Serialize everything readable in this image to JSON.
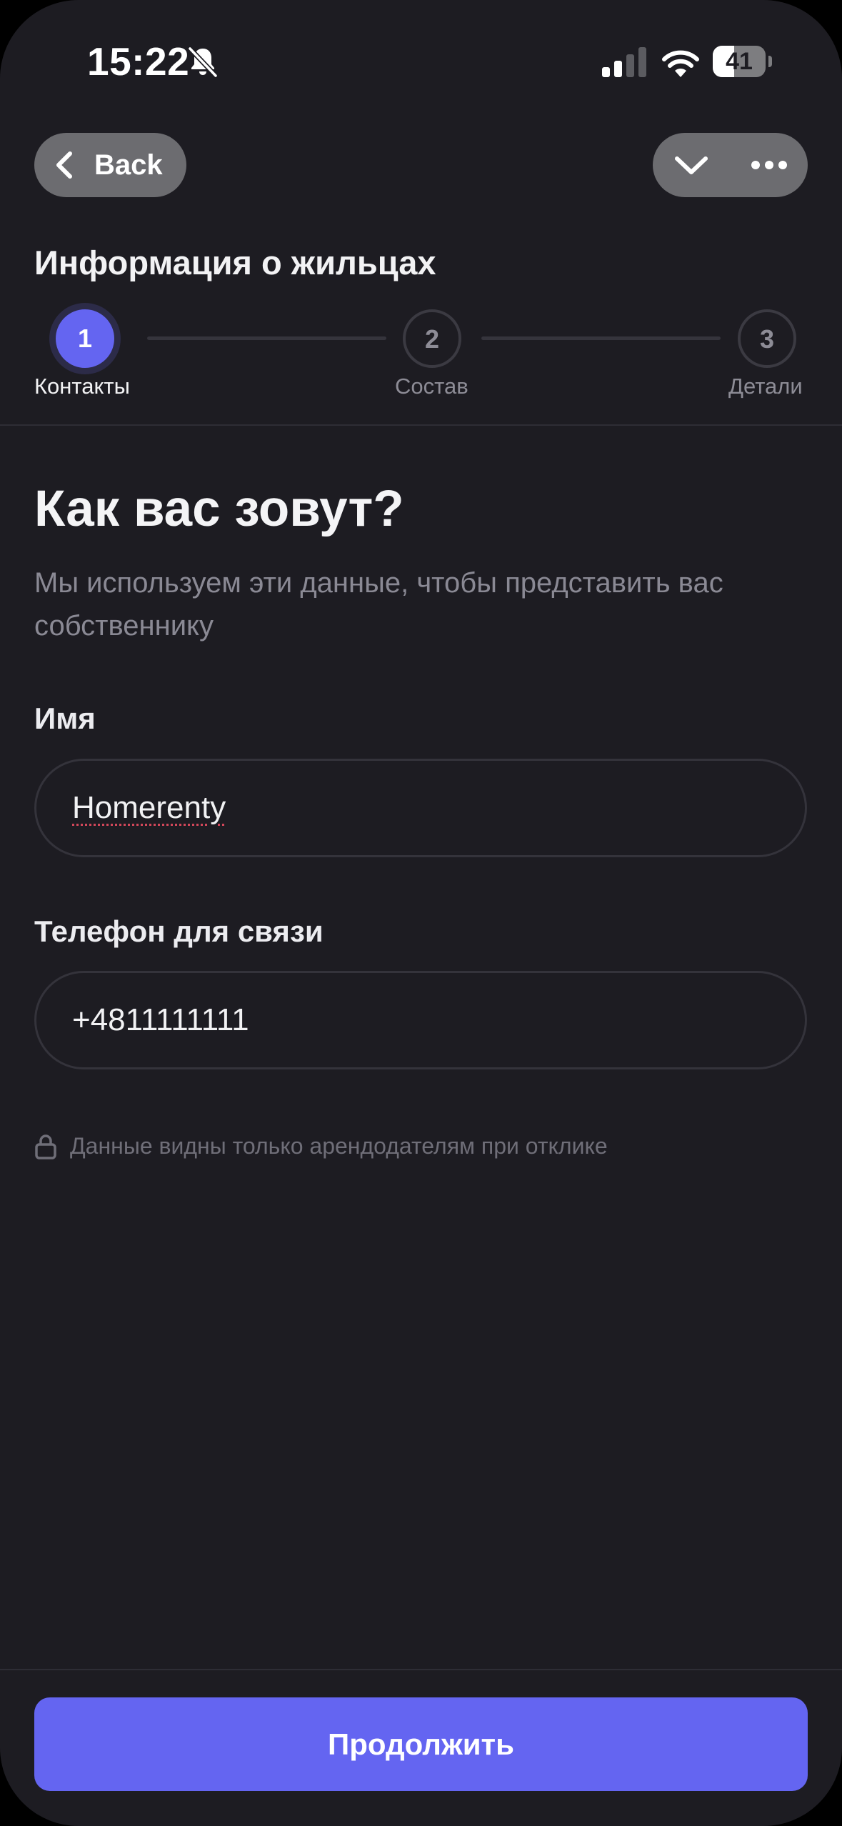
{
  "status_bar": {
    "time": "15:22",
    "battery_level": "41",
    "battery_fraction": 0.41
  },
  "nav": {
    "back_label": "Back"
  },
  "section": {
    "title": "Информация о жильцах"
  },
  "stepper": {
    "steps": [
      {
        "number": "1",
        "label": "Контакты",
        "state": "active"
      },
      {
        "number": "2",
        "label": "Состав",
        "state": "inactive"
      },
      {
        "number": "3",
        "label": "Детали",
        "state": "inactive"
      }
    ]
  },
  "page": {
    "title": "Как вас зовут?",
    "subtitle": "Мы используем эти данные, чтобы представить вас собственнику"
  },
  "form": {
    "name": {
      "label": "Имя",
      "value": "Homerenty"
    },
    "phone": {
      "label": "Телефон для связи",
      "value": "+4811111111"
    },
    "privacy_note": "Данные видны только арендодателям при отклике"
  },
  "footer": {
    "continue_label": "Продолжить"
  },
  "colors": {
    "background": "#1d1c22",
    "accent": "#6465f1",
    "pill_gray": "#6c6c70",
    "muted_text": "#8a8994"
  }
}
